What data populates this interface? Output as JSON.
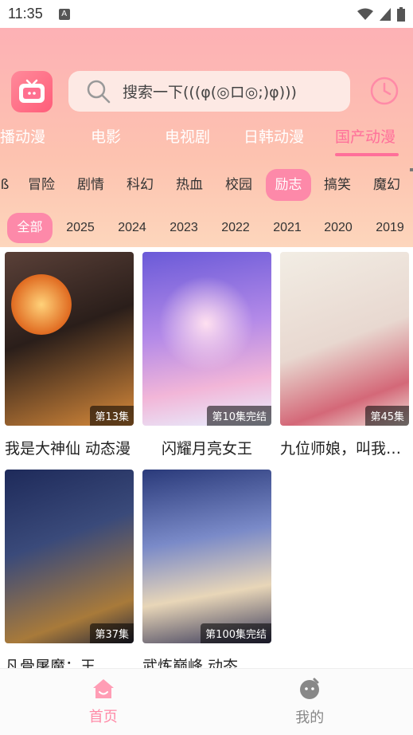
{
  "status": {
    "time": "11:35",
    "notif_letter": "A"
  },
  "search": {
    "placeholder": "搜索一下(((φ(◎ロ◎;)φ)))"
  },
  "tabs": [
    {
      "label": "播动漫",
      "active": false
    },
    {
      "label": "电影",
      "active": false
    },
    {
      "label": "电视剧",
      "active": false
    },
    {
      "label": "日韩动漫",
      "active": false
    },
    {
      "label": "国产动漫",
      "active": true
    }
  ],
  "genres": [
    {
      "label": "冒险",
      "active": false
    },
    {
      "label": "剧情",
      "active": false
    },
    {
      "label": "科幻",
      "active": false
    },
    {
      "label": "热血",
      "active": false
    },
    {
      "label": "校园",
      "active": false
    },
    {
      "label": "励志",
      "active": true
    },
    {
      "label": "搞笑",
      "active": false
    },
    {
      "label": "魔幻",
      "active": false
    }
  ],
  "years": [
    {
      "label": "全部",
      "active": true
    },
    {
      "label": "2025",
      "active": false
    },
    {
      "label": "2024",
      "active": false
    },
    {
      "label": "2023",
      "active": false
    },
    {
      "label": "2022",
      "active": false
    },
    {
      "label": "2021",
      "active": false
    },
    {
      "label": "2020",
      "active": false
    },
    {
      "label": "2019",
      "active": false
    }
  ],
  "cards": [
    {
      "title": "我是大神仙 动态漫",
      "badge": "第13集",
      "colors": [
        "#3a2a24",
        "#d88a3a"
      ]
    },
    {
      "title": "闪耀月亮女王",
      "badge": "第10集完结",
      "colors": [
        "#5a7bd8",
        "#f0a6d8"
      ]
    },
    {
      "title": "九位师娘，叫我下山",
      "badge": "第45集",
      "colors": [
        "#e9e4dc",
        "#c85a6a"
      ]
    },
    {
      "title": "凡骨屠魔：王",
      "badge": "第37集",
      "colors": [
        "#23315a",
        "#c89a3a"
      ]
    },
    {
      "title": "武炼巅峰 动态",
      "badge": "第100集完结",
      "colors": [
        "#6a7ab8",
        "#e8d6b8"
      ]
    }
  ],
  "bottom_nav": [
    {
      "label": "首页",
      "icon": "home-icon",
      "active": true
    },
    {
      "label": "我的",
      "icon": "profile-icon",
      "active": false
    }
  ],
  "colors": {
    "accent": "#fd89a9",
    "active_tab": "#ff6f9a"
  }
}
